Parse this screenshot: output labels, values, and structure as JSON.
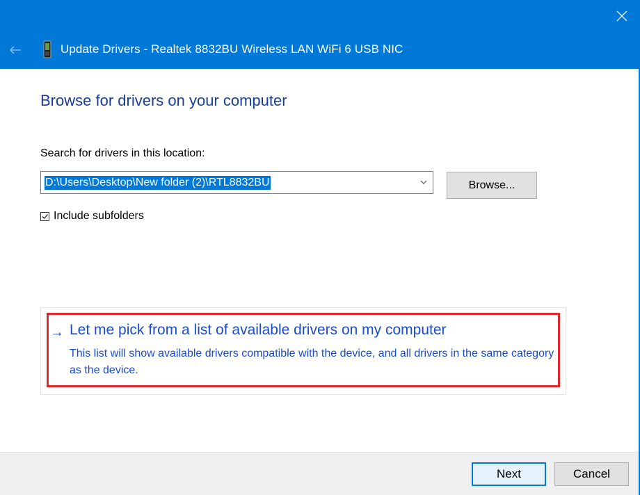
{
  "window": {
    "title": "Update Drivers - Realtek 8832BU Wireless LAN WiFi 6 USB NIC",
    "close_icon": "close-icon",
    "back_icon": "back-arrow-icon",
    "device_icon": "network-adapter-icon"
  },
  "content": {
    "heading": "Browse for drivers on your computer",
    "search_label": "Search for drivers in this location:",
    "path_value": "D:\\Users\\Desktop\\New folder (2)\\RTL8832BU",
    "browse_label": "Browse...",
    "include_subfolders_label": "Include subfolders",
    "include_subfolders_checked": true
  },
  "option": {
    "arrow": "→",
    "title": "Let me pick from a list of available drivers on my computer",
    "description": "This list will show available drivers compatible with the device, and all drivers in the same category as the device."
  },
  "footer": {
    "next_label": "Next",
    "cancel_label": "Cancel"
  },
  "colors": {
    "accent": "#0078d7",
    "heading": "#1a3e9d",
    "link": "#1a4bd1",
    "highlight_border": "#e0282e"
  }
}
